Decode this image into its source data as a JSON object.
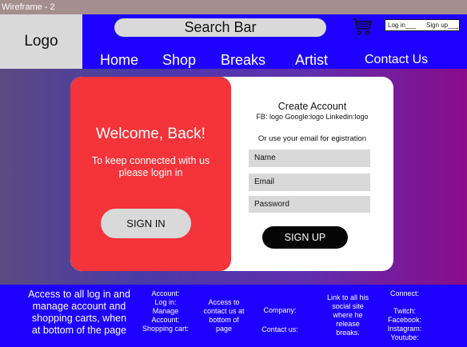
{
  "window": {
    "title": "Wireframe - 2"
  },
  "header": {
    "logo": "Logo",
    "search": "Search Bar",
    "cart_icon": "shopping-cart-icon",
    "auth": {
      "login": "Log in___",
      "signup": "Sign up___"
    },
    "nav": [
      "Home",
      "Shop",
      "Breaks",
      "Artist",
      "Contact Us"
    ]
  },
  "welcome": {
    "title": "Welcome, Back!",
    "subtitle_line1": "To keep connected with us",
    "subtitle_line2": "please login in",
    "button": "SIGN IN"
  },
  "create_account": {
    "title": "Create Account",
    "social": "FB: logo Google:logo Linkedin:logo",
    "or_text": "Or use your email for egistration",
    "fields": [
      "Name",
      "Email",
      "Password"
    ],
    "button": "SIGN UP"
  },
  "footer": {
    "intro": [
      "Access to all log in and",
      "manage account and",
      "shopping carts, when",
      "at bottom of the page"
    ],
    "account": [
      "Account:",
      "Log in:",
      "Manage",
      "Account:",
      "Shopping cart:"
    ],
    "contact_note": [
      "Access to",
      "contact us at",
      "bottom of",
      "page"
    ],
    "company": [
      "Company:",
      "Contact us:"
    ],
    "artist_link": [
      "Link to all his",
      "social site",
      "where he",
      "release",
      "breaks."
    ],
    "connect": [
      "Connect:",
      "",
      "Twitch:",
      "Facebook:",
      "Instagram:",
      "Youtube:"
    ]
  },
  "colors": {
    "header_blue": "#1e00ff",
    "welcome_red": "#f4333a",
    "placeholder_gray": "#d9d9d9",
    "signup_black": "#050505"
  }
}
